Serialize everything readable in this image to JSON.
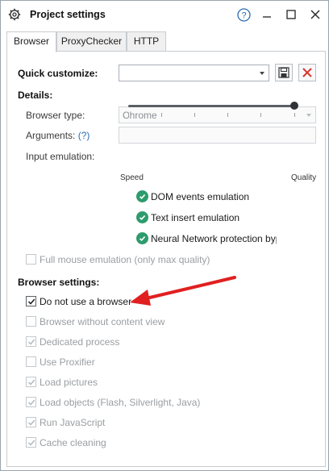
{
  "window": {
    "title": "Project settings",
    "controls": {
      "help": "?",
      "minimize": "—",
      "maximize": "☐",
      "close": "✕"
    }
  },
  "tabs": [
    {
      "label": "Browser",
      "active": true
    },
    {
      "label": "ProxyChecker",
      "active": false
    },
    {
      "label": "HTTP",
      "active": false
    }
  ],
  "quick_customize": {
    "label": "Quick customize:",
    "value": ""
  },
  "details": {
    "heading": "Details:",
    "browser_type": {
      "label": "Browser type:",
      "value": "Chrome"
    },
    "arguments": {
      "label": "Arguments:",
      "help": "(?)",
      "value": ""
    },
    "input_emulation": {
      "label": "Input emulation:",
      "min_label": "Speed",
      "max_label": "Quality",
      "level": 1.0
    },
    "features": [
      "DOM events emulation",
      "Text insert emulation",
      "Neural Network protection bypas"
    ],
    "full_mouse": {
      "label": "Full mouse emulation (only max quality)",
      "checked": false
    }
  },
  "browser_settings": {
    "heading": "Browser settings:",
    "items": [
      {
        "label": "Do not use a browser",
        "checked": true,
        "enabled": true
      },
      {
        "label": "Browser without content view",
        "checked": false,
        "enabled": false
      },
      {
        "label": "Dedicated process",
        "checked": true,
        "enabled": false
      },
      {
        "label": "Use Proxifier",
        "checked": false,
        "enabled": false
      },
      {
        "label": "Load pictures",
        "checked": true,
        "enabled": false
      },
      {
        "label": "Load objects (Flash, Silverlight, Java)",
        "checked": true,
        "enabled": false
      },
      {
        "label": "Run JavaScript",
        "checked": true,
        "enabled": false
      },
      {
        "label": "Cache cleaning",
        "checked": true,
        "enabled": false
      }
    ]
  },
  "colors": {
    "accent_green": "#2e9b6d",
    "help_blue": "#2b6cb0",
    "delete_red": "#d9342b",
    "arrow_red": "#e02020"
  }
}
